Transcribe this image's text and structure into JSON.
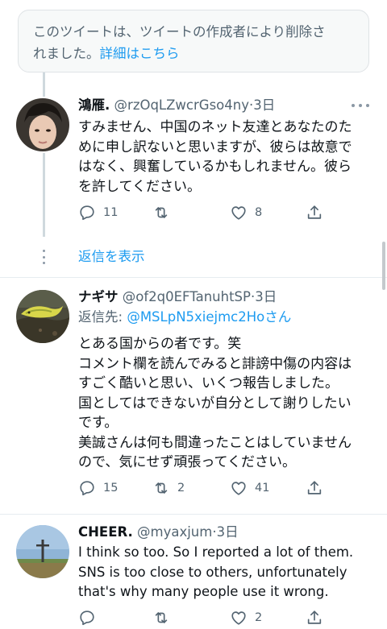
{
  "deleted_notice": {
    "text": "このツイートは、ツイートの作成者により削除されました。",
    "line1": "このツイートは、ツイートの作成者により削除さ",
    "line2_prefix": "れました。",
    "learn_more": "詳細はこちら"
  },
  "tweets": [
    {
      "name": "鴻雁.",
      "handle": "@rzOqLZwcrGso4ny",
      "dot": "·",
      "time": "3日",
      "body_lines": [
        "すみません、中国のネット友達とあなたのた",
        "めに申し訳ないと思いますが、彼らは故意で",
        "はなく、興奮しているかもしれません。彼ら",
        "を許してください。"
      ],
      "reply_count": "11",
      "retweet_count": "",
      "like_count": "8"
    },
    {
      "name": "ナギサ",
      "handle": "@of2q0EFTanuhtSP",
      "dot": "·",
      "time": "3日",
      "replying_label": "返信先: ",
      "replying_to": "@MSLpN5xiejmc2Hoさん",
      "body_lines": [
        "とある国からの者です。笑",
        "コメント欄を読んでみると誹謗中傷の内容は",
        "すごく酷いと思い、いくつ報告しました。",
        "国としてはできないが自分として謝りしたい",
        "です。",
        "美誠さんは何も間違ったことはしていません",
        "ので、気にせず頑張ってください。"
      ],
      "reply_count": "15",
      "retweet_count": "2",
      "like_count": "41"
    },
    {
      "name": "CHEER.",
      "handle": "@myaxjum",
      "dot": "·",
      "time": "3日",
      "body_lines": [
        "I think so too. So I reported a lot of them.",
        "SNS is too close to others, unfortunately",
        "that's why many people use it wrong."
      ],
      "reply_count": "",
      "retweet_count": "",
      "like_count": "2"
    }
  ],
  "show_replies": "返信を表示",
  "colors": {
    "accent": "#1d9bf0",
    "secondary_text": "#536471",
    "primary_text": "#0f1419",
    "border": "#e6ecf0"
  },
  "icons": [
    "reply-icon",
    "retweet-icon",
    "like-icon",
    "share-icon",
    "more-icon"
  ]
}
